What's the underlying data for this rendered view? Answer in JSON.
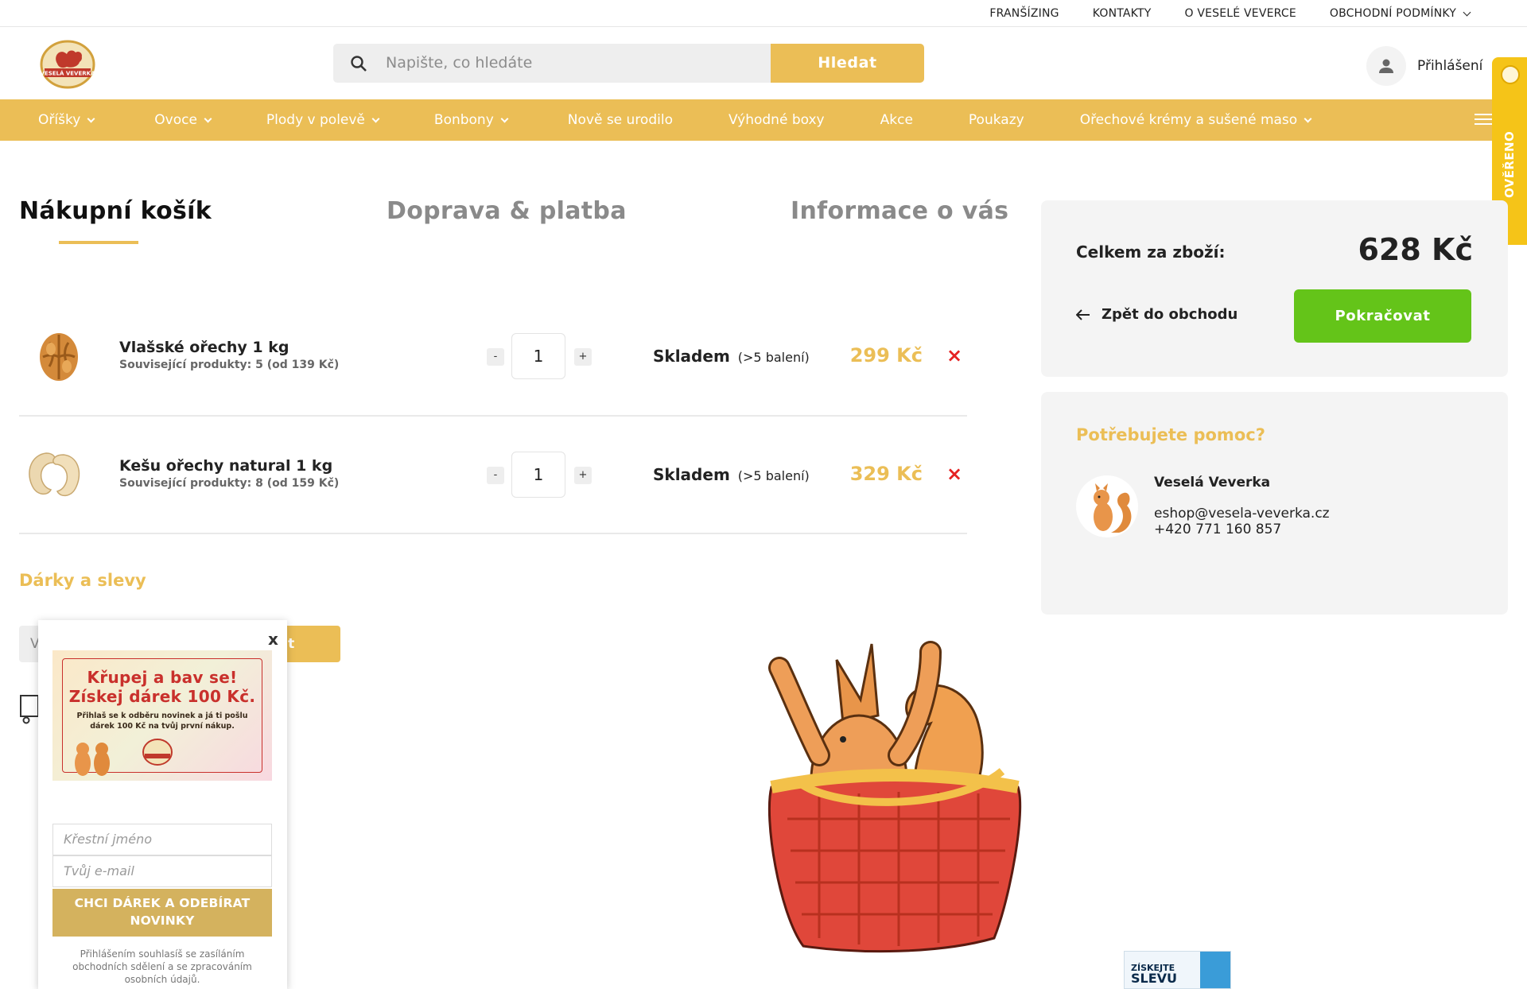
{
  "topbar": {
    "links": [
      "FRANŠÍZING",
      "KONTAKTY",
      "O VESELÉ VEVERCE",
      "OBCHODNÍ PODMÍNKY"
    ]
  },
  "header": {
    "logo_text": "VESELÁ VEVERKA",
    "search_placeholder": "Napište, co hledáte",
    "search_button": "Hledat",
    "account_label": "Přihlášení"
  },
  "nav": {
    "items": [
      {
        "label": "Oříšky",
        "dropdown": true
      },
      {
        "label": "Ovoce",
        "dropdown": true
      },
      {
        "label": "Plody v polevě",
        "dropdown": true
      },
      {
        "label": "Bonbony",
        "dropdown": true
      },
      {
        "label": "Nově se urodilo",
        "dropdown": false
      },
      {
        "label": "Výhodné boxy",
        "dropdown": false
      },
      {
        "label": "Akce",
        "dropdown": false
      },
      {
        "label": "Poukazy",
        "dropdown": false
      },
      {
        "label": "Ořechové krémy a sušené maso",
        "dropdown": true
      }
    ]
  },
  "badge": {
    "text": "OVĚŘENO ZÁKAZNÍKY"
  },
  "steps": [
    "Nákupní košík",
    "Doprava & platba",
    "Informace o vás"
  ],
  "cart": {
    "items": [
      {
        "name": "Vlašské ořechy 1 kg",
        "related": "Související produkty: 5 (od 139 Kč)",
        "qty": "1",
        "minus": "-",
        "plus": "+",
        "stock": "Skladem",
        "stock_note": "(>5 balení)",
        "price": "299 Kč",
        "remove": "×",
        "image": "walnut-icon"
      },
      {
        "name": "Kešu ořechy natural 1 kg",
        "related": "Související produkty: 8 (od 159 Kč)",
        "qty": "1",
        "minus": "-",
        "plus": "+",
        "stock": "Skladem",
        "stock_note": "(>5 balení)",
        "price": "329 Kč",
        "remove": "×",
        "image": "cashew-icon"
      }
    ],
    "gifts_title": "Dárky a slevy",
    "voucher_placeholder": "V",
    "voucher_button": "Přidat"
  },
  "summary": {
    "total_label": "Celkem za zboží:",
    "total_value": "628 Kč",
    "back_label": "Zpět do obchodu",
    "continue_label": "Pokračovat"
  },
  "help": {
    "title": "Potřebujete pomoc?",
    "name": "Veselá Veverka",
    "email": "eshop@vesela-veverka.cz",
    "phone": "+420 771 160 857"
  },
  "popup": {
    "close": "x",
    "headline_1": "Křupej a bav se!",
    "headline_2": "Získej dárek 100 Kč.",
    "small_text": "Přihlaš se k odběru novinek a já ti pošlu dárek 100 Kč na tvůj první nákup.",
    "first_name_placeholder": "Křestní jméno",
    "email_placeholder": "Tvůj e-mail",
    "submit_label": "CHCI DÁREK A ODEBÍRAT NOVINKY",
    "consent": "Přihlášením souhlasíš se zasíláním obchodních sdělení a se zpracováním osobních údajů."
  },
  "discount_widget": {
    "line1": "ZÍSKEJTE",
    "line2": "SLEVU"
  },
  "colors": {
    "accent": "#ebbe56",
    "continue": "#64c419",
    "remove": "#e52222",
    "badge": "#f5c418"
  }
}
